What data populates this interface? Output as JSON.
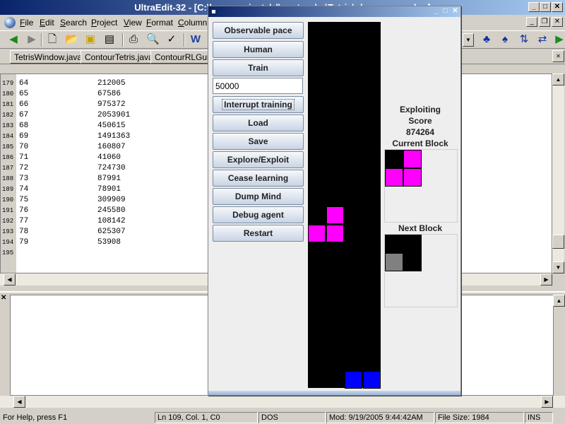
{
  "app": {
    "title": "UltraEdit-32 - [C:\\hons projects\\rl\\contour\\...\\Tetris\\playerscores.log]",
    "window_buttons": [
      "_",
      "□",
      "✕"
    ]
  },
  "menu": [
    "File",
    "Edit",
    "Search",
    "Project",
    "View",
    "Format",
    "Column"
  ],
  "mdi_buttons": [
    "_",
    "❐",
    "✕"
  ],
  "tabs": [
    "TetrisWindow.java",
    "ContourTetris.java",
    "ContourRLGuru..."
  ],
  "editor": {
    "lines": [
      {
        "ln": "179",
        "a": "64",
        "b": "212005"
      },
      {
        "ln": "180",
        "a": "65",
        "b": "67586"
      },
      {
        "ln": "181",
        "a": "66",
        "b": "975372"
      },
      {
        "ln": "182",
        "a": "67",
        "b": "2053901"
      },
      {
        "ln": "183",
        "a": "68",
        "b": "450615"
      },
      {
        "ln": "184",
        "a": "69",
        "b": "1491363"
      },
      {
        "ln": "185",
        "a": "70",
        "b": "160807"
      },
      {
        "ln": "186",
        "a": "71",
        "b": "41060"
      },
      {
        "ln": "187",
        "a": "72",
        "b": "724730"
      },
      {
        "ln": "188",
        "a": "73",
        "b": "87991"
      },
      {
        "ln": "189",
        "a": "74",
        "b": "78901"
      },
      {
        "ln": "190",
        "a": "75",
        "b": "309909"
      },
      {
        "ln": "191",
        "a": "76",
        "b": "245580"
      },
      {
        "ln": "192",
        "a": "77",
        "b": "108142"
      },
      {
        "ln": "193",
        "a": "78",
        "b": "625307"
      },
      {
        "ln": "194",
        "a": "79",
        "b": "53908"
      },
      {
        "ln": "195",
        "a": "",
        "b": ""
      }
    ]
  },
  "status": {
    "help": "For Help, press F1",
    "position": "Ln 109, Col. 1, C0",
    "format": "DOS",
    "modified": "Mod: 9/19/2005 9:44:42AM",
    "filesize": "File Size: 1984",
    "mode": "INS"
  },
  "tetris": {
    "buttons": {
      "observable_pace": "Observable pace",
      "human": "Human",
      "train": "Train",
      "interrupt": "Interrupt training",
      "load": "Load",
      "save": "Save",
      "explore": "Explore/Exploit",
      "cease": "Cease learning",
      "dump": "Dump Mind",
      "debug": "Debug agent",
      "restart": "Restart"
    },
    "training_episodes": "50000",
    "mode_label": "Exploiting",
    "score_label": "Score",
    "score_value": "874264",
    "current_block_label": "Current Block",
    "next_block_label": "Next Block",
    "colors": {
      "magenta": "#ff00ff",
      "blue": "#0000ff",
      "gray": "#808080",
      "board": "#000000"
    }
  }
}
